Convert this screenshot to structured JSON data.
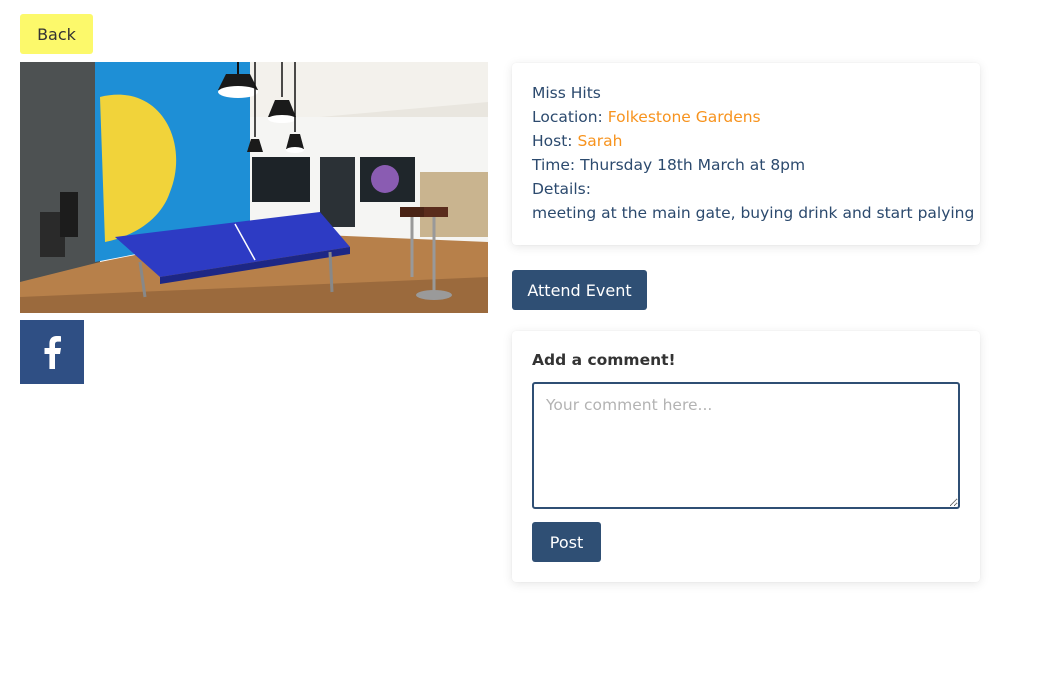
{
  "nav": {
    "back_label": "Back"
  },
  "event": {
    "title": "Miss Hits",
    "location_label": "Location: ",
    "location_value": "Folkestone Gardens",
    "host_label": "Host: ",
    "host_value": "Sarah",
    "time_text": "Time: Thursday 18th March at 8pm",
    "details_label": "Details:",
    "details_text": "meeting at the main gate, buying drink and start palying"
  },
  "actions": {
    "attend_label": "Attend Event"
  },
  "share": {
    "icon": "facebook-icon"
  },
  "comment": {
    "title": "Add a comment!",
    "placeholder": "Your comment here...",
    "post_label": "Post"
  },
  "colors": {
    "back_button": "#fcf96b",
    "primary_button": "#2f4f74",
    "facebook": "#2f4f84",
    "accent_link": "#f7931e",
    "text": "#2c4a6e"
  }
}
